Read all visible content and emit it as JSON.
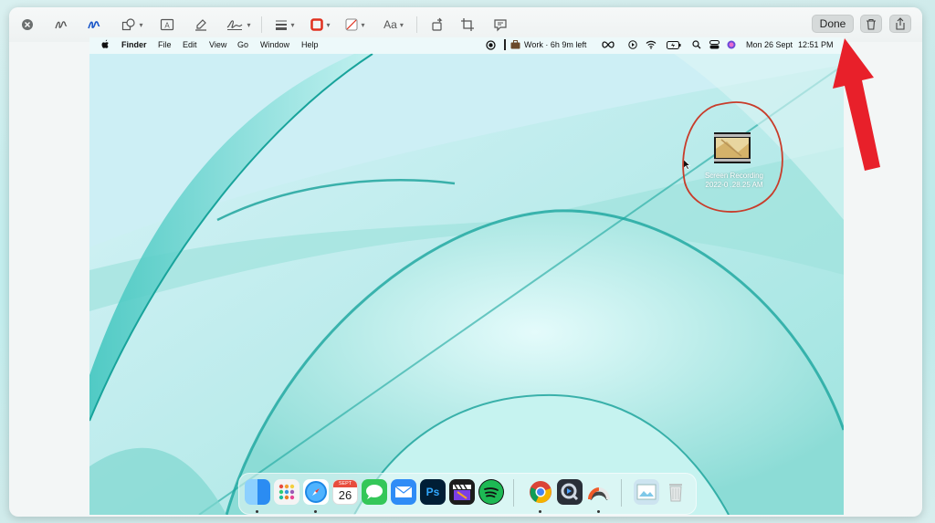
{
  "toolbar": {
    "close_icon": "close-circle-icon",
    "tools": [
      "sketch-icon",
      "draw-icon",
      "shapes-icon",
      "text-box-icon",
      "highlight-icon",
      "signature-icon",
      "line-style-icon",
      "border-color-icon",
      "fill-color-icon",
      "text-style-icon",
      "rotate-icon",
      "crop-icon",
      "description-icon"
    ],
    "text_style_label": "Aa",
    "done_label": "Done",
    "border_color": "#e0301e"
  },
  "menubar": {
    "apple_icon": "apple-logo-icon",
    "items": [
      "Finder",
      "File",
      "Edit",
      "View",
      "Go",
      "Window",
      "Help"
    ],
    "work_status": "Work · 6h 9m left",
    "date": "Mon 26 Sept",
    "time": "12:51 PM"
  },
  "desktop": {
    "file_name_line1": "Screen Recording",
    "file_name_line2": "2022-0  .28.25 AM"
  },
  "dock": {
    "apps": [
      {
        "name": "finder",
        "color": "#2b8cf2"
      },
      {
        "name": "launchpad",
        "color": "#f0f0f0"
      },
      {
        "name": "safari",
        "color": "#1e88e5"
      },
      {
        "name": "calendar",
        "color": "#ffffff"
      },
      {
        "name": "messages",
        "color": "#34c759"
      },
      {
        "name": "mail",
        "color": "#2f8cf6"
      },
      {
        "name": "photoshop",
        "color": "#001e36"
      },
      {
        "name": "final-cut-pro",
        "color": "#1c1c1c"
      },
      {
        "name": "spotify",
        "color": "#1db954"
      },
      {
        "name": "chrome",
        "color": "#ffffff"
      },
      {
        "name": "quicktime",
        "color": "#2a2f38"
      },
      {
        "name": "istat-menus",
        "color": "#ffffff"
      },
      {
        "name": "preview",
        "color": "#cde4f0"
      },
      {
        "name": "trash",
        "color": "#dfe3e3"
      }
    ],
    "calendar_month": "SEPT",
    "calendar_day": "26",
    "photoshop_label": "Ps"
  },
  "annotation": {
    "circle_color": "#c83c2a",
    "arrow_color": "#e8202a"
  }
}
